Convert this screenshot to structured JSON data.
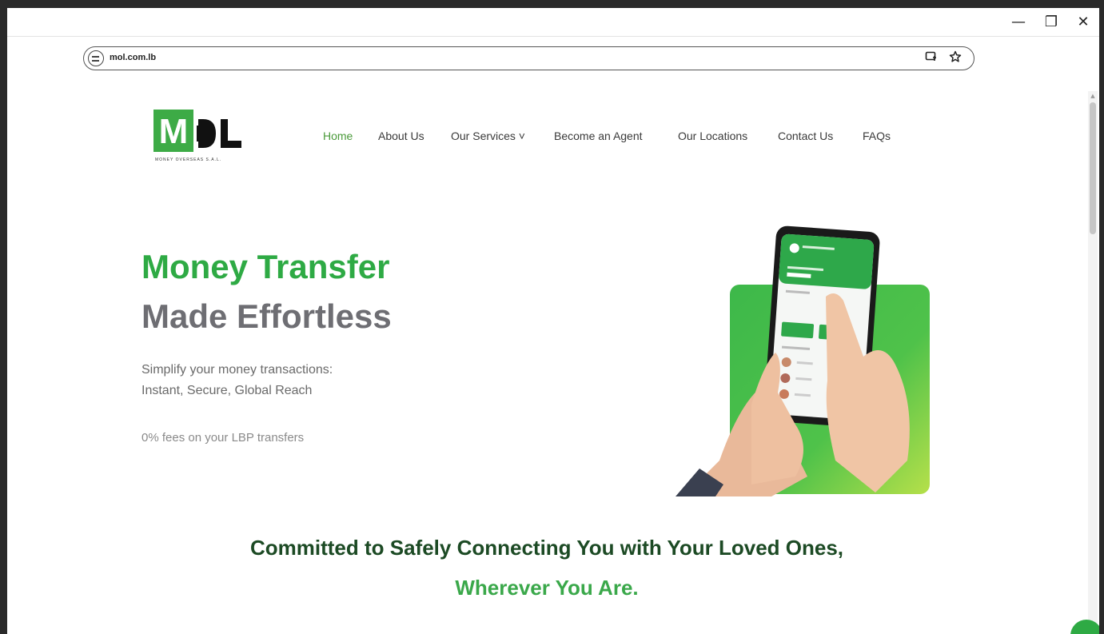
{
  "browser": {
    "url": "mol.com.lb",
    "window_controls": {
      "minimize": "—",
      "restore": "❐",
      "close": "✕"
    }
  },
  "logo": {
    "letter_m": "M",
    "letters_rest": "◖L",
    "tagline": "MONEY OVERSEAS S.A.L."
  },
  "nav": {
    "items": [
      {
        "label": "Home",
        "active": true
      },
      {
        "label": "About Us"
      },
      {
        "label": "Our Services ˅"
      },
      {
        "label": "Become an Agent"
      },
      {
        "label": "Our Locations"
      },
      {
        "label": "Contact Us"
      },
      {
        "label": "FAQs"
      }
    ]
  },
  "hero": {
    "title_line1": "Money Transfer",
    "title_line2": "Made Effortless",
    "desc_line1": "Simplify your money transactions:",
    "desc_line2": "Instant, Secure, Global Reach",
    "fees": "0% fees on your LBP transfers"
  },
  "commitment": {
    "line1": "Committed to Safely Connecting You with Your Loved Ones,",
    "line2": "Wherever You Are."
  },
  "colors": {
    "brand_green": "#2eaa44",
    "dark_green": "#1c4a24",
    "gray_title": "#6e6e73"
  }
}
